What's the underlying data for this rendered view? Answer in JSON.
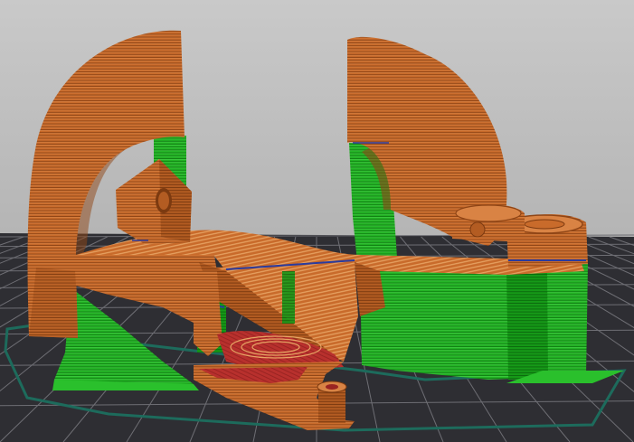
{
  "viewer": {
    "mode": "sliced-preview",
    "colors": {
      "background_top": "#c4c4c4",
      "background_bottom": "#a4a4a4",
      "bed": "#2e2e33",
      "bed_grid": "#6e6e74",
      "skirt": "#1f6a5c",
      "perimeter": "#c96b2b",
      "perimeter_dark": "#9c4d1a",
      "perimeter_light": "#e19050",
      "infill": "#e8a060",
      "solid_infill": "#b8302d",
      "top_solid": "#c23a35",
      "support": "#22b324",
      "support_dark": "#168018",
      "support_light": "#4dd34e",
      "bridge": "#2a3b9e"
    },
    "icons": {
      "bed": "print-bed-grid",
      "skirt": "skirt-outline",
      "model": "toolpath-model"
    }
  }
}
